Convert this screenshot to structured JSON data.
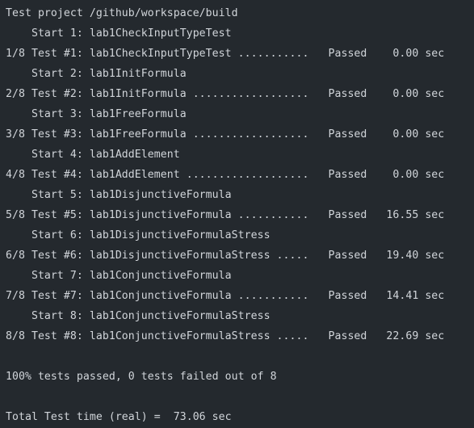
{
  "terminal": {
    "lines": [
      "Test project /github/workspace/build",
      "    Start 1: lab1CheckInputTypeTest",
      "1/8 Test #1: lab1CheckInputTypeTest ...........   Passed    0.00 sec",
      "    Start 2: lab1InitFormula",
      "2/8 Test #2: lab1InitFormula ..................   Passed    0.00 sec",
      "    Start 3: lab1FreeFormula",
      "3/8 Test #3: lab1FreeFormula ..................   Passed    0.00 sec",
      "    Start 4: lab1AddElement",
      "4/8 Test #4: lab1AddElement ...................   Passed    0.00 sec",
      "    Start 5: lab1DisjunctiveFormula",
      "5/8 Test #5: lab1DisjunctiveFormula ...........   Passed   16.55 sec",
      "    Start 6: lab1DisjunctiveFormulaStress",
      "6/8 Test #6: lab1DisjunctiveFormulaStress .....   Passed   19.40 sec",
      "    Start 7: lab1ConjunctiveFormula",
      "7/8 Test #7: lab1ConjunctiveFormula ...........   Passed   14.41 sec",
      "    Start 8: lab1ConjunctiveFormulaStress",
      "8/8 Test #8: lab1ConjunctiveFormulaStress .....   Passed   22.69 sec",
      "",
      "100% tests passed, 0 tests failed out of 8",
      "",
      "Total Test time (real) =  73.06 sec"
    ]
  },
  "colors": {
    "background": "#24292e",
    "text": "#d1d5da"
  }
}
